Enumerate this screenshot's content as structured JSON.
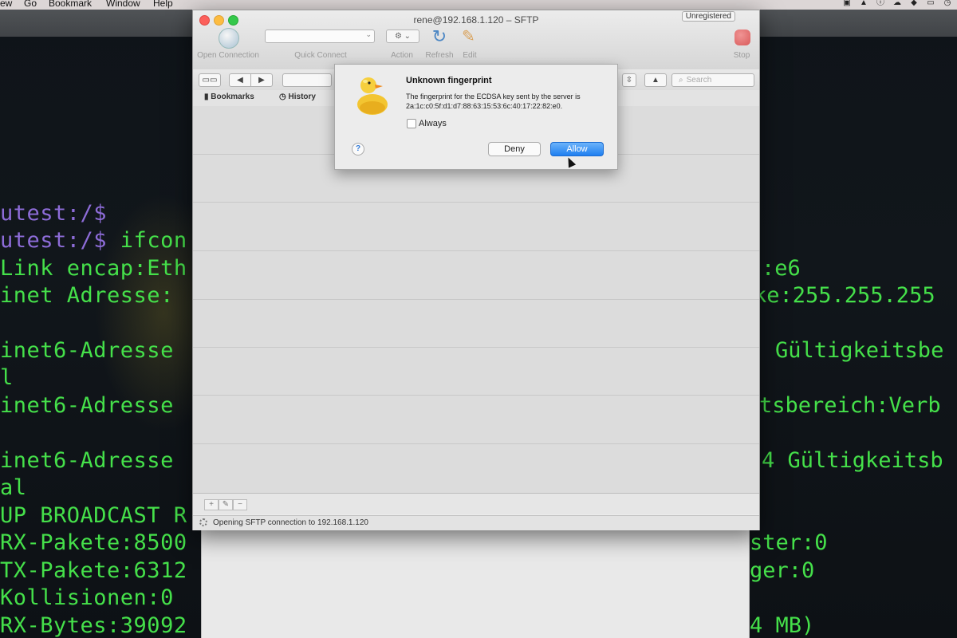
{
  "menubar": {
    "items": [
      "ew",
      "Go",
      "Bookmark",
      "Window",
      "Help"
    ]
  },
  "terminal": {
    "left_lines": [
      "utest:/$",
      "utest:/$ ifcon",
      "Link encap:Eth",
      "inet Adresse:",
      "",
      "inet6-Adresse",
      "l",
      "inet6-Adresse",
      "",
      "inet6-Adresse",
      "al",
      "UP BROADCAST R",
      "RX-Pakete:8500",
      "TX-Pakete:6312",
      "Kollisionen:0",
      "RX-Bytes:39092"
    ],
    "right_lines": [
      ":e6",
      "ke:255.255.255",
      "Gültigkeitsbe",
      "tsbereich:Verb",
      "4 Gültigkeitsb",
      "ster:0",
      "ger:0",
      "4 MB)"
    ]
  },
  "window": {
    "title": "rene@192.168.1.120 – SFTP",
    "unregistered": "Unregistered",
    "toolbar": {
      "open_connection": "Open Connection",
      "quick_connect": "Quick Connect",
      "action": "Action",
      "refresh": "Refresh",
      "edit": "Edit",
      "stop": "Stop"
    },
    "search_placeholder": "Search",
    "tabs": {
      "bookmarks": "Bookmarks",
      "history": "History"
    },
    "status": "Opening SFTP connection to 192.168.1.120"
  },
  "dialog": {
    "title": "Unknown fingerprint",
    "message": "The fingerprint for the ECDSA key sent by the server is 2a:1c:c0:5f:d1:d7:88:63:15:53:6c:40:17:22:82:e0.",
    "always_label": "Always",
    "deny": "Deny",
    "allow": "Allow",
    "help": "?"
  },
  "colors": {
    "terminal_text": "#45e04a",
    "prompt_accent": "#8d6cd8",
    "allow_button": "#1f7ff0",
    "stop_icon": "#d83a3a"
  }
}
